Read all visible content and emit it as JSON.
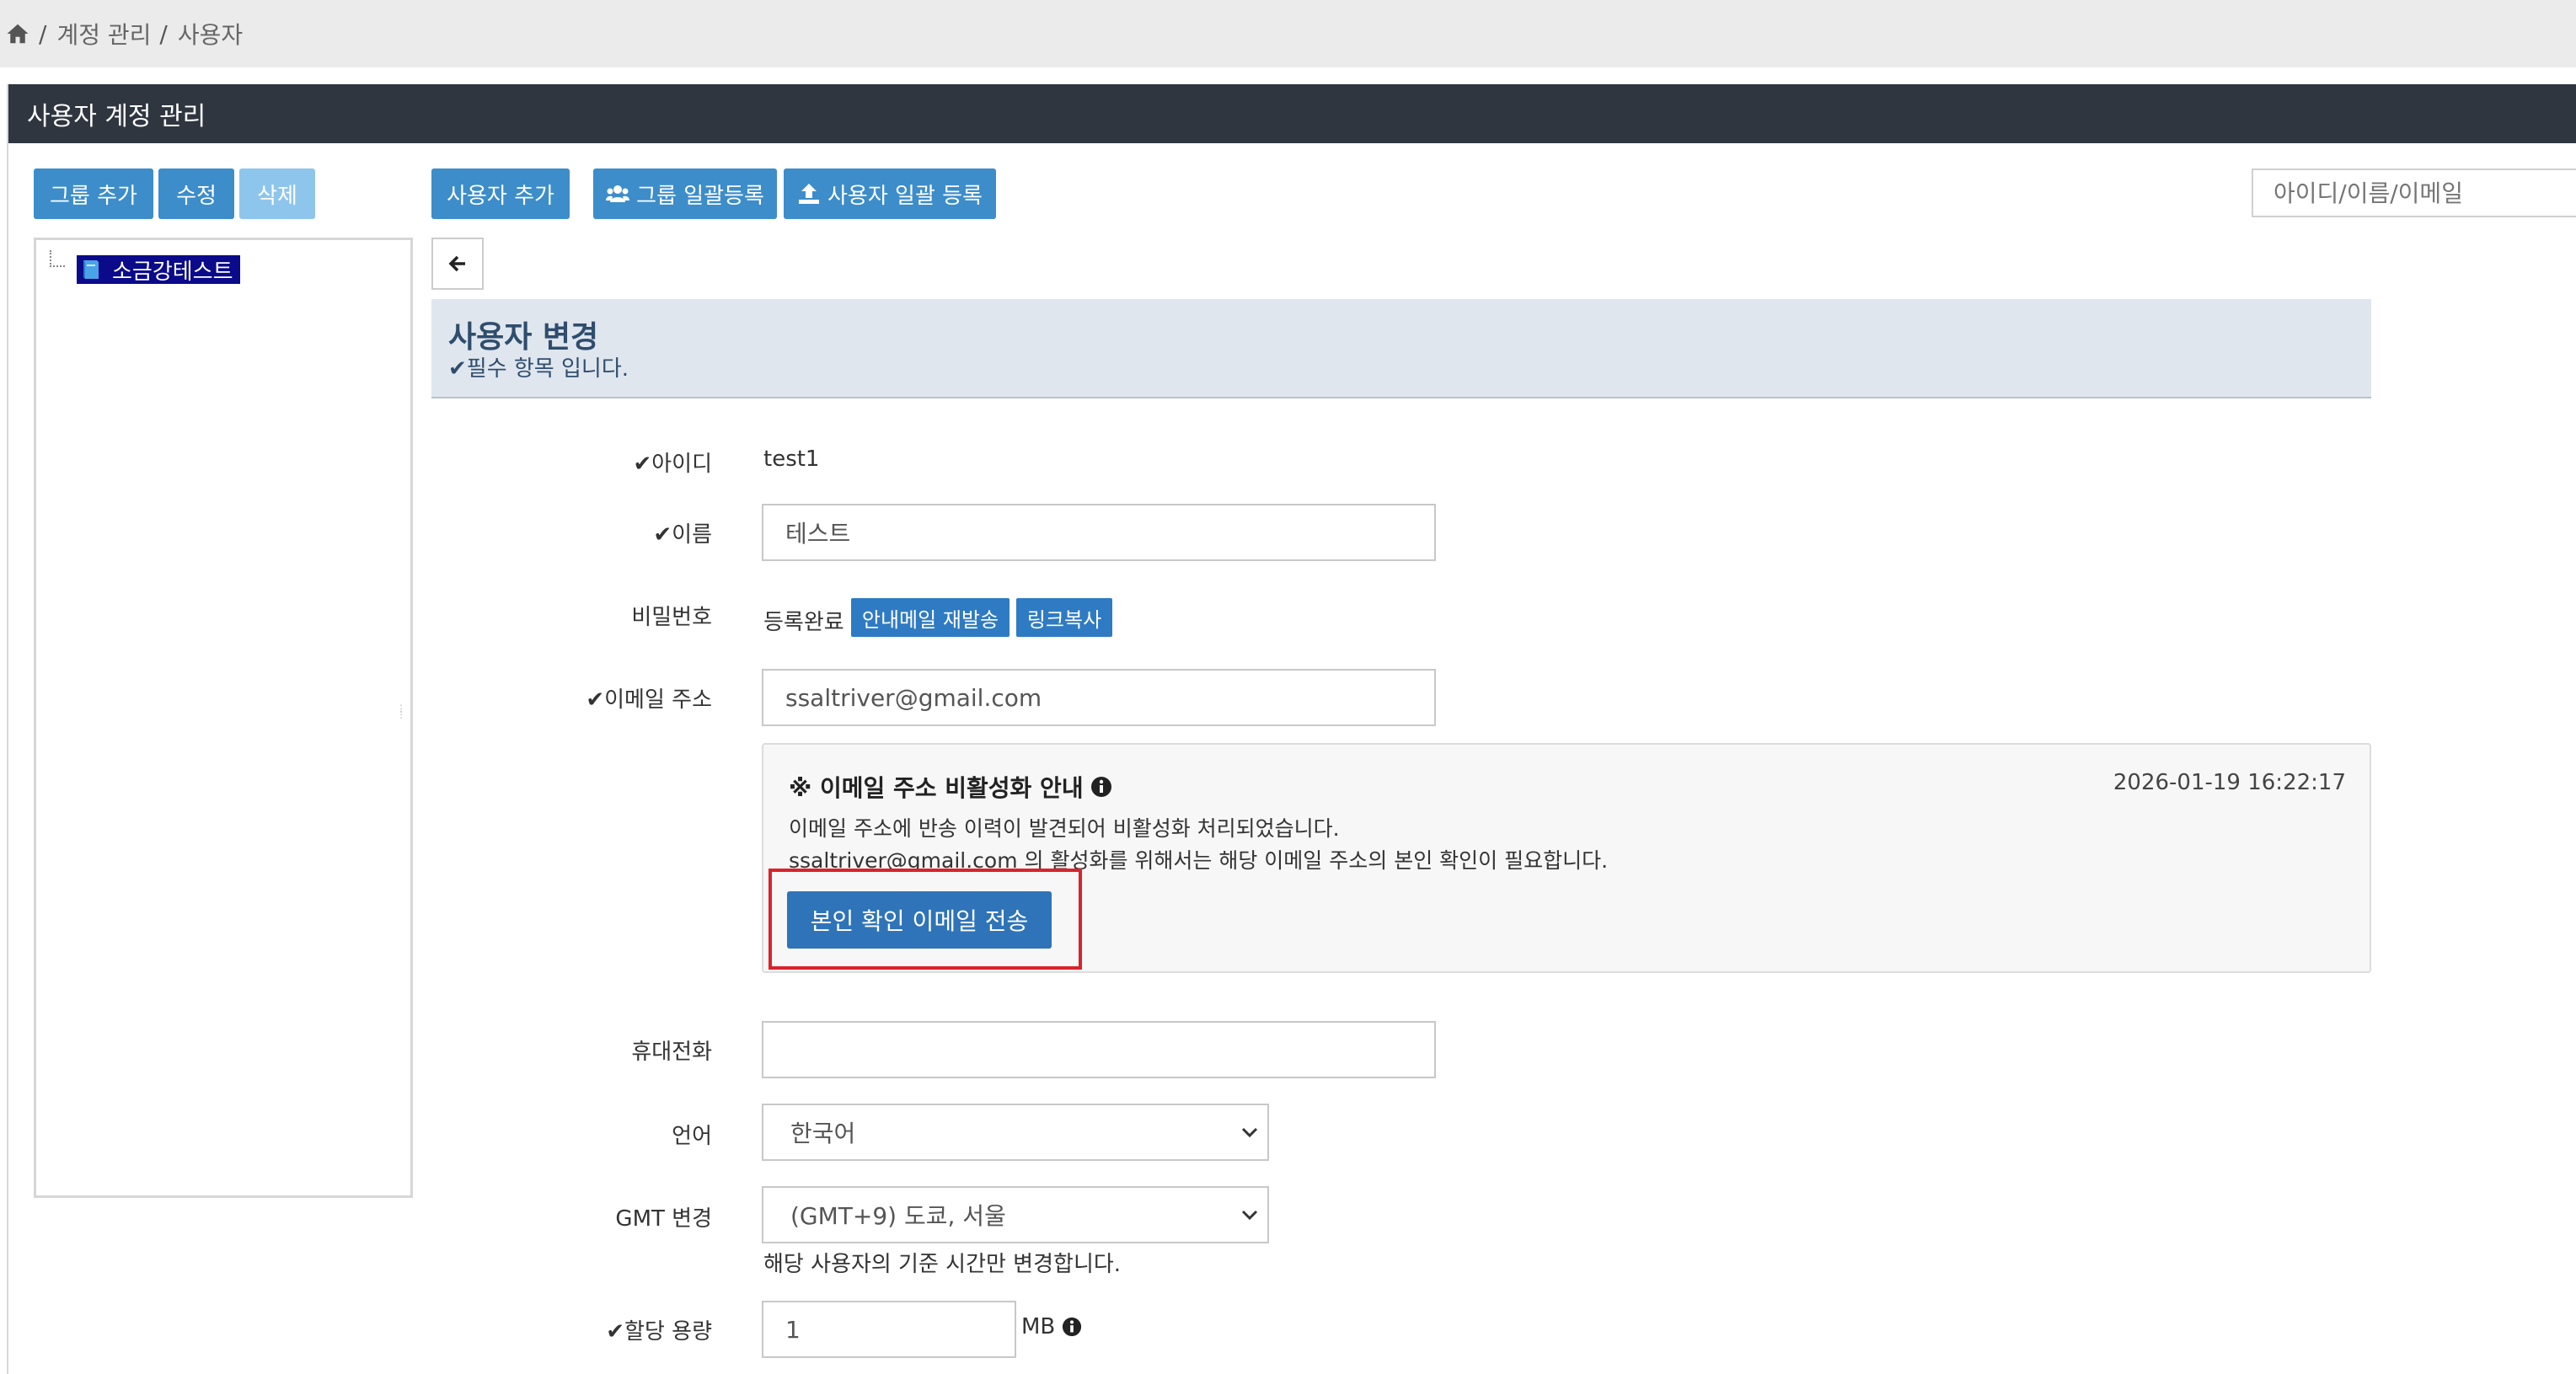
{
  "breadcrumb": {
    "items": [
      "계정 관리",
      "사용자"
    ],
    "separator": "/"
  },
  "panel": {
    "title": "사용자 계정 관리"
  },
  "toolbar": {
    "group_add": "그룹 추가",
    "edit": "수정",
    "delete": "삭제",
    "user_add": "사용자 추가",
    "group_bulk": "그룹 일괄등록",
    "user_bulk": "사용자 일괄 등록",
    "search_placeholder": "아이디/이름/이메일"
  },
  "tree": {
    "root": "소금강테스트"
  },
  "form": {
    "title": "사용자 변경",
    "subtitle": "✔필수 항목 입니다.",
    "id_label": "✔아이디",
    "id_value": "test1",
    "name_label": "✔이름",
    "name_value": "테스트",
    "password_label": "비밀번호",
    "password_status": "등록완료",
    "resend_button": "안내메일 재발송",
    "copy_link_button": "링크복사",
    "email_label": "✔이메일 주소",
    "email_value": "ssaltriver@gmail.com",
    "phone_label": "휴대전화",
    "phone_value": "",
    "language_label": "언어",
    "language_value": "한국어",
    "gmt_label": "GMT 변경",
    "gmt_value": "(GMT+9) 도쿄, 서울",
    "gmt_help": "해당 사용자의 기준 시간만 변경합니다.",
    "quota_label": "✔할당 용량",
    "quota_value": "1",
    "quota_unit": "MB"
  },
  "notice": {
    "title": "※ 이메일 주소 비활성화 안내",
    "date": "2026-01-19 16:22:17",
    "line1": "이메일 주소에 반송 이력이 발견되어 비활성화 처리되었습니다.",
    "line2": "ssaltriver@gmail.com 의 활성화를 위해서는 해당 이메일 주소의 본인 확인이 필요합니다.",
    "verify_button": "본인 확인 이메일 전송"
  },
  "colors": {
    "primary": "#3c8dca",
    "header": "#2f3640",
    "highlight": "#d9232b",
    "tree_selected": "#0a0a8a"
  }
}
